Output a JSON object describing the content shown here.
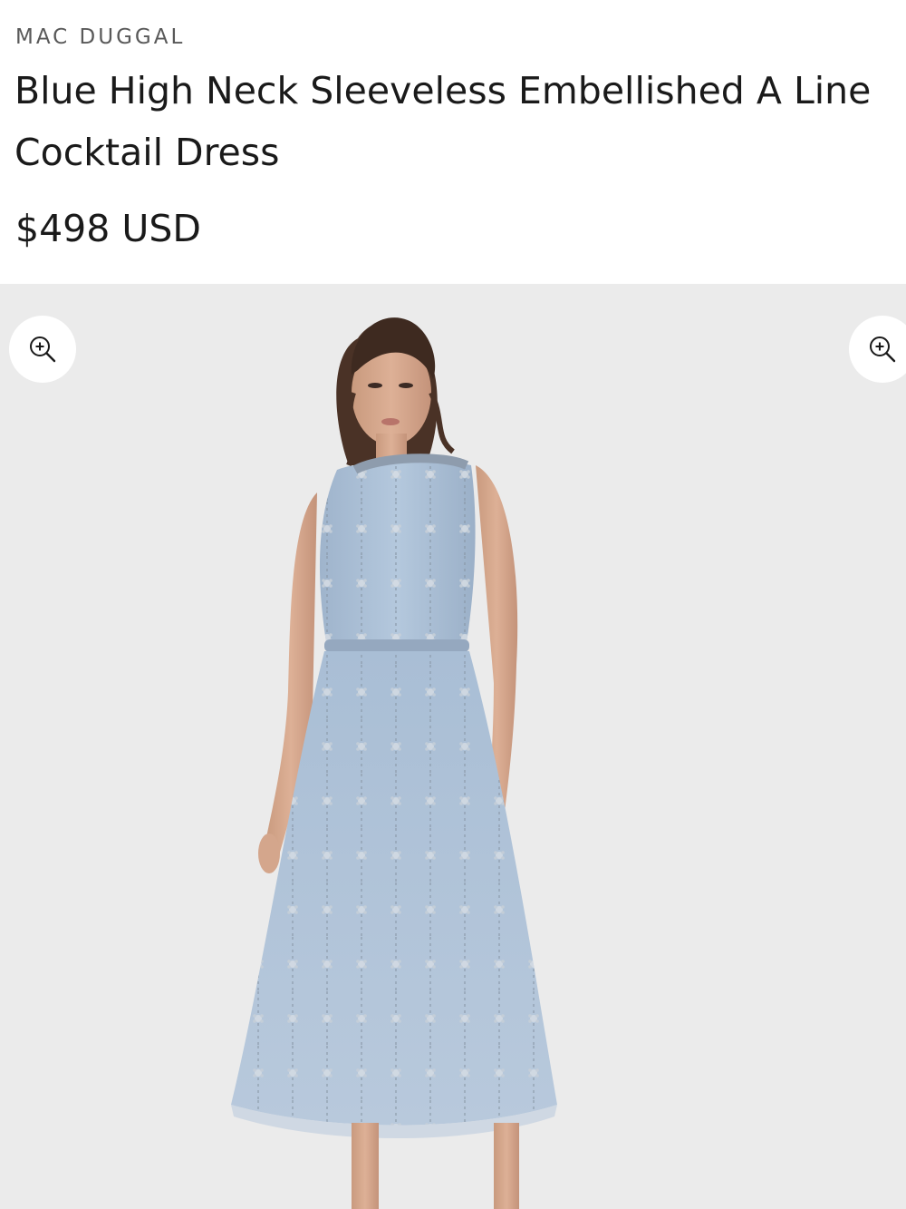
{
  "product": {
    "brand": "MAC DUGGAL",
    "title": "Blue High Neck Sleeveless Embellished A Line Cocktail Dress",
    "price": "$498 USD"
  },
  "gallery": {
    "zoom_icon": "zoom-in-icon",
    "background_color": "#ebebeb",
    "dress_color": "#a9bfd6"
  }
}
